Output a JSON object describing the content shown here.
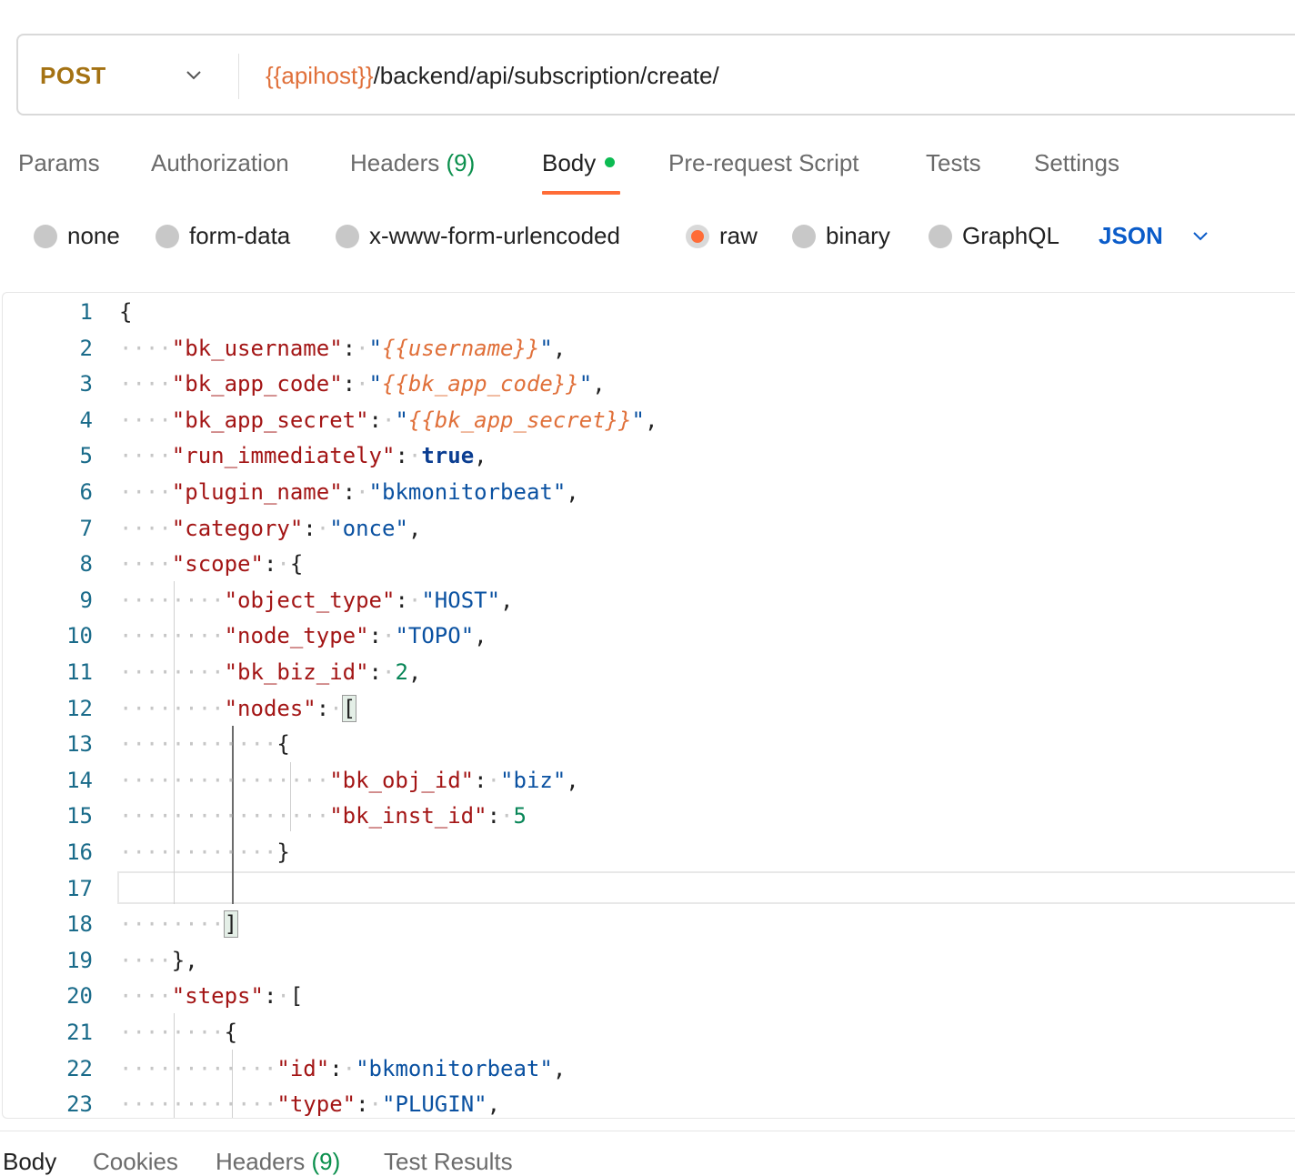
{
  "request": {
    "method": "POST",
    "url_variable": "{{apihost}}",
    "url_path": "/backend/api/subscription/create/"
  },
  "tabs": {
    "params": "Params",
    "authorization": "Authorization",
    "headers": "Headers",
    "headers_count": "(9)",
    "body": "Body",
    "prerequest": "Pre-request Script",
    "tests": "Tests",
    "settings": "Settings",
    "active": "Body"
  },
  "body_types": {
    "none": "none",
    "form_data": "form-data",
    "urlencoded": "x-www-form-urlencoded",
    "raw": "raw",
    "binary": "binary",
    "graphql": "GraphQL",
    "selected": "raw",
    "language": "JSON"
  },
  "editor": {
    "line_numbers": [
      "1",
      "2",
      "3",
      "4",
      "5",
      "6",
      "7",
      "8",
      "9",
      "10",
      "11",
      "12",
      "13",
      "14",
      "15",
      "16",
      "17",
      "18",
      "19",
      "20",
      "21",
      "22",
      "23"
    ],
    "code": {
      "open": "{",
      "k_username": "\"bk_username\"",
      "v_username": "{{username}}",
      "k_app_code": "\"bk_app_code\"",
      "v_app_code": "{{bk_app_code}}",
      "k_app_secret": "\"bk_app_secret\"",
      "v_app_secret": "{{bk_app_secret}}",
      "k_run": "\"run_immediately\"",
      "v_run": "true",
      "k_plugin": "\"plugin_name\"",
      "v_plugin": "\"bkmonitorbeat\"",
      "k_category": "\"category\"",
      "v_category": "\"once\"",
      "k_scope": "\"scope\"",
      "k_object_type": "\"object_type\"",
      "v_object_type": "\"HOST\"",
      "k_node_type": "\"node_type\"",
      "v_node_type": "\"TOPO\"",
      "k_biz": "\"bk_biz_id\"",
      "v_biz": "2",
      "k_nodes": "\"nodes\"",
      "k_obj_id": "\"bk_obj_id\"",
      "v_obj_id": "\"biz\"",
      "k_inst_id": "\"bk_inst_id\"",
      "v_inst_id": "5",
      "k_steps": "\"steps\"",
      "k_id": "\"id\"",
      "v_id": "\"bkmonitorbeat\"",
      "k_type": "\"type\"",
      "v_type": "\"PLUGIN\""
    }
  },
  "response_tabs": {
    "body": "Body",
    "cookies": "Cookies",
    "headers": "Headers",
    "headers_count": "(9)",
    "test_results": "Test Results"
  },
  "colors": {
    "accent": "#ff6c37",
    "method": "#a47213",
    "variable": "#e0703a",
    "key": "#a31515",
    "string": "#0a51a1",
    "number": "#098658",
    "link": "#0b5cc9",
    "count": "#0a8f4c"
  }
}
